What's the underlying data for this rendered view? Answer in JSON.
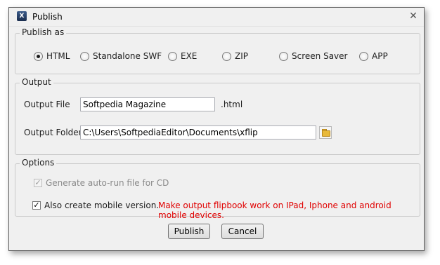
{
  "window": {
    "title": "Publish",
    "close_glyph": "✕",
    "app_icon_letter": "X"
  },
  "publish_as": {
    "title": "Publish as",
    "options": [
      {
        "label": "HTML",
        "checked": true
      },
      {
        "label": "Standalone SWF",
        "checked": false
      },
      {
        "label": "EXE",
        "checked": false
      },
      {
        "label": "ZIP",
        "checked": false
      },
      {
        "label": "Screen Saver",
        "checked": false
      },
      {
        "label": "APP",
        "checked": false
      }
    ]
  },
  "output": {
    "title": "Output",
    "file_label": "Output File",
    "file_value": "Softpedia Magazine",
    "file_ext": ".html",
    "folder_label": "Output Folder",
    "folder_value": "C:\\Users\\SoftpediaEditor\\Documents\\xflip"
  },
  "options": {
    "title": "Options",
    "autorun_label": "Generate auto-run file for CD",
    "mobile_label": "Also create mobile version.",
    "mobile_note": "Make output flipbook work on IPad, Iphone and android mobile devices."
  },
  "buttons": {
    "publish": "Publish",
    "cancel": "Cancel"
  },
  "colors": {
    "note_red": "#e00000",
    "window_bg": "#f0f0f0"
  }
}
